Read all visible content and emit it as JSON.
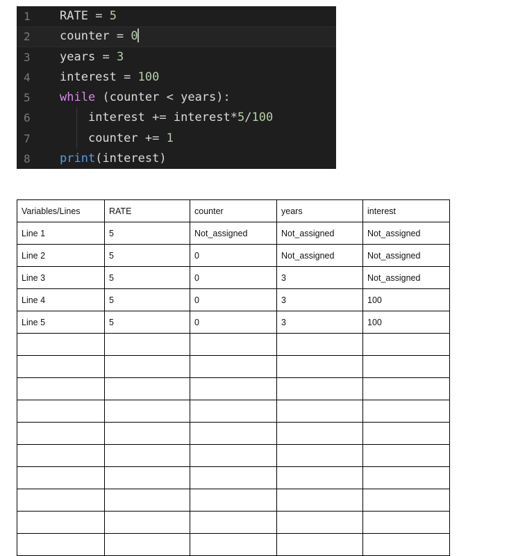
{
  "code_editor": {
    "language": "python",
    "theme": {
      "background": "#1e1e1e",
      "active_line_background": "#242424",
      "gutter_text": "#7a7a7a",
      "keyword": "#d48ae8",
      "function": "#4f9fe8",
      "number": "#b5cea8",
      "identifier": "#dcdcdc",
      "cursor": "#b8b8b8"
    },
    "cursor_line": 2,
    "lines": [
      {
        "number": "1",
        "active": false,
        "indent_guide": false,
        "tokens": [
          {
            "t": "RATE",
            "k": "id"
          },
          {
            "t": " ",
            "k": "op"
          },
          {
            "t": "=",
            "k": "op"
          },
          {
            "t": " ",
            "k": "op"
          },
          {
            "t": "5",
            "k": "num"
          }
        ]
      },
      {
        "number": "2",
        "active": true,
        "indent_guide": false,
        "cursor_after": true,
        "tokens": [
          {
            "t": "counter",
            "k": "id"
          },
          {
            "t": " ",
            "k": "op"
          },
          {
            "t": "=",
            "k": "op"
          },
          {
            "t": " ",
            "k": "op"
          },
          {
            "t": "0",
            "k": "num"
          }
        ]
      },
      {
        "number": "3",
        "active": false,
        "indent_guide": false,
        "tokens": [
          {
            "t": "years",
            "k": "id"
          },
          {
            "t": " ",
            "k": "op"
          },
          {
            "t": "=",
            "k": "op"
          },
          {
            "t": " ",
            "k": "op"
          },
          {
            "t": "3",
            "k": "num"
          }
        ]
      },
      {
        "number": "4",
        "active": false,
        "indent_guide": false,
        "tokens": [
          {
            "t": "interest",
            "k": "id"
          },
          {
            "t": " ",
            "k": "op"
          },
          {
            "t": "=",
            "k": "op"
          },
          {
            "t": " ",
            "k": "op"
          },
          {
            "t": "100",
            "k": "num"
          }
        ]
      },
      {
        "number": "5",
        "active": false,
        "indent_guide": false,
        "tokens": [
          {
            "t": "while",
            "k": "kw"
          },
          {
            "t": " ",
            "k": "op"
          },
          {
            "t": "(",
            "k": "punc"
          },
          {
            "t": "counter",
            "k": "id"
          },
          {
            "t": " ",
            "k": "op"
          },
          {
            "t": "<",
            "k": "op"
          },
          {
            "t": " ",
            "k": "op"
          },
          {
            "t": "years",
            "k": "id"
          },
          {
            "t": ")",
            "k": "punc"
          },
          {
            "t": ":",
            "k": "punc"
          }
        ]
      },
      {
        "number": "6",
        "active": false,
        "indent_guide": true,
        "tokens": [
          {
            "t": "    ",
            "k": "op"
          },
          {
            "t": "interest",
            "k": "id"
          },
          {
            "t": " ",
            "k": "op"
          },
          {
            "t": "+=",
            "k": "op"
          },
          {
            "t": " ",
            "k": "op"
          },
          {
            "t": "interest",
            "k": "id"
          },
          {
            "t": "*",
            "k": "op"
          },
          {
            "t": "5",
            "k": "num"
          },
          {
            "t": "/",
            "k": "op"
          },
          {
            "t": "100",
            "k": "num"
          }
        ]
      },
      {
        "number": "7",
        "active": false,
        "indent_guide": true,
        "tokens": [
          {
            "t": "    ",
            "k": "op"
          },
          {
            "t": "counter",
            "k": "id"
          },
          {
            "t": " ",
            "k": "op"
          },
          {
            "t": "+=",
            "k": "op"
          },
          {
            "t": " ",
            "k": "op"
          },
          {
            "t": "1",
            "k": "num"
          }
        ]
      },
      {
        "number": "8",
        "active": false,
        "indent_guide": false,
        "tokens": [
          {
            "t": "print",
            "k": "fn"
          },
          {
            "t": "(",
            "k": "punc"
          },
          {
            "t": "interest",
            "k": "id"
          },
          {
            "t": ")",
            "k": "punc"
          }
        ]
      }
    ]
  },
  "trace_table": {
    "headers": [
      "Variables/Lines",
      "RATE",
      "counter",
      "years",
      "interest"
    ],
    "rows": [
      [
        "Line 1",
        "5",
        "Not_assigned",
        "Not_assigned",
        "Not_assigned"
      ],
      [
        "Line 2",
        "5",
        "0",
        "Not_assigned",
        "Not_assigned"
      ],
      [
        "Line 3",
        "5",
        "0",
        "3",
        "Not_assigned"
      ],
      [
        "Line 4",
        "5",
        "0",
        "3",
        "100"
      ],
      [
        "Line 5",
        "5",
        "0",
        "3",
        "100"
      ],
      [
        "",
        "",
        "",
        "",
        ""
      ],
      [
        "",
        "",
        "",
        "",
        ""
      ],
      [
        "",
        "",
        "",
        "",
        ""
      ],
      [
        "",
        "",
        "",
        "",
        ""
      ],
      [
        "",
        "",
        "",
        "",
        ""
      ],
      [
        "",
        "",
        "",
        "",
        ""
      ],
      [
        "",
        "",
        "",
        "",
        ""
      ],
      [
        "",
        "",
        "",
        "",
        ""
      ],
      [
        "",
        "",
        "",
        "",
        ""
      ],
      [
        "",
        "",
        "",
        "",
        ""
      ]
    ]
  }
}
